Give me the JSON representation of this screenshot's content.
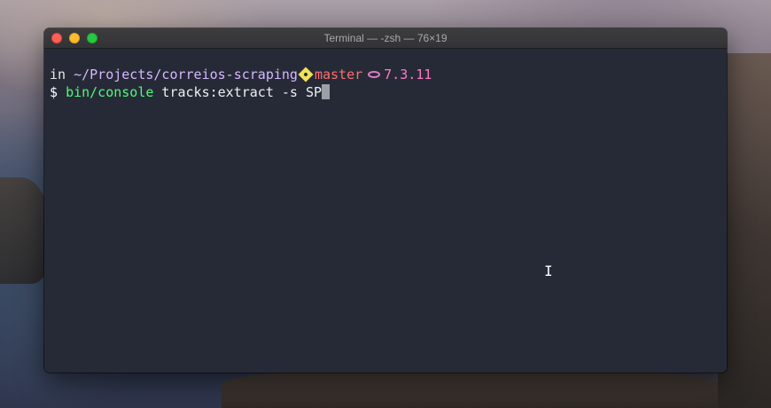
{
  "window": {
    "title": "Terminal — -zsh — 76×19"
  },
  "terminal": {
    "line1": {
      "prefix": "in ",
      "path": "~/Projects/correios-scraping",
      "git_icon": "git-branch-icon",
      "branch": "master",
      "php_icon": "php-icon",
      "php_version": "7.3.11"
    },
    "line2": {
      "prompt": "$ ",
      "command": "bin/console",
      "args": " tracks:extract -s SP"
    }
  },
  "cursor": {
    "icon": "ibeam-cursor-icon",
    "glyph": "I"
  },
  "colors": {
    "terminal_bg": "#262a37",
    "path": "#d7b8ff",
    "branch": "#ff6e6e",
    "php": "#ff79c6",
    "command": "#50fa7b"
  }
}
